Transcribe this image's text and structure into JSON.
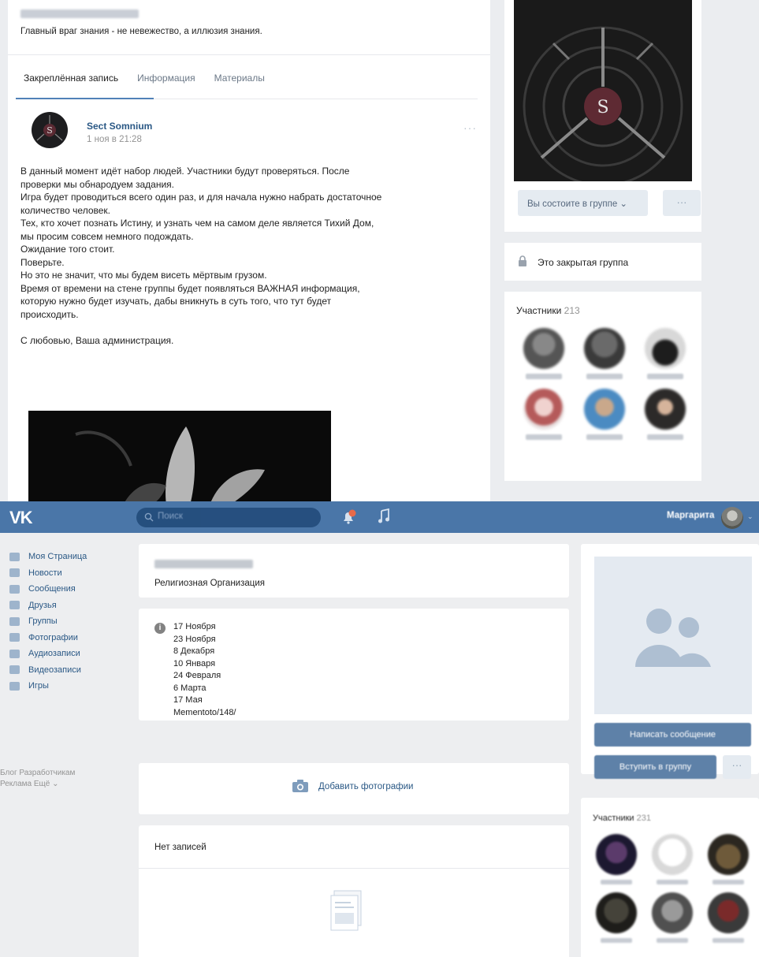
{
  "top": {
    "group_name_blurred": "Sect Somnium",
    "status": "Главный враг знания - не невежество, а иллюзия знания.",
    "tabs": [
      {
        "label": "Закреплённая запись",
        "active": true
      },
      {
        "label": "Информация",
        "active": false
      },
      {
        "label": "Материалы",
        "active": false
      }
    ],
    "post": {
      "author": "Sect Somnium",
      "date": "1 ноя в 21:28",
      "more": "···",
      "lines": [
        "В данный момент идёт набор людей. Участники будут проверяться. После",
        "проверки мы обнародуем задания.",
        "Игра будет проводиться всего один раз, и для начала нужно набрать достаточное",
        "количество человек.",
        "Тех, кто хочет познать Истину, и узнать чем на самом деле является Тихий Дом,",
        "мы просим совсем немного подождать.",
        "Ожидание того стоит.",
        "Поверьте.",
        "Но это не значит, что мы будем висеть мёртвым грузом.",
        "Время от времени на стене группы будет появляться ВАЖНАЯ информация,",
        "которую нужно будет изучать, дабы вникнуть в суть того, что тут будет",
        "происходить.",
        "",
        "С любовью, Ваша администрация."
      ]
    },
    "sidebar": {
      "member_button": "Вы состоите в группе ⌄",
      "more_button": "···",
      "closed_group": "Это закрытая группа",
      "participants_label": "Участники",
      "participants_count": "213"
    }
  },
  "bottom": {
    "header": {
      "logo": "VK",
      "search_placeholder": "Поиск",
      "notification_badge": "1",
      "user_name": "Маргарита",
      "caret": "⌄"
    },
    "menu": [
      {
        "label": "Моя Страница",
        "icon": "home-icon"
      },
      {
        "label": "Новости",
        "icon": "news-icon"
      },
      {
        "label": "Сообщения",
        "icon": "messages-icon"
      },
      {
        "label": "Друзья",
        "icon": "friends-icon"
      },
      {
        "label": "Группы",
        "icon": "groups-icon"
      },
      {
        "label": "Фотографии",
        "icon": "photos-icon"
      },
      {
        "label": "Аудиозаписи",
        "icon": "audio-icon"
      },
      {
        "label": "Видеозаписи",
        "icon": "video-icon"
      },
      {
        "label": "Игры",
        "icon": "games-icon"
      }
    ],
    "menu_footer": {
      "line1": "Блог  Разработчикам",
      "line2": "Реклама  Ещё ⌄"
    },
    "group": {
      "name_blurred": "Тихий дом",
      "type": "Религиозная Организация",
      "dates": [
        "17 Ноября",
        "23 Ноября",
        "8 Декабря",
        "10 Января",
        "24 Февраля",
        "6 Марта",
        "17 Мая",
        "Mementoto/148/"
      ]
    },
    "add_photos": "Добавить фотографии",
    "no_posts": "Нет записей",
    "write_message": "Написать сообщение",
    "join_group": "Вступить в группу",
    "join_more": "···",
    "participants_label": "Участники",
    "participants_count": "231"
  }
}
